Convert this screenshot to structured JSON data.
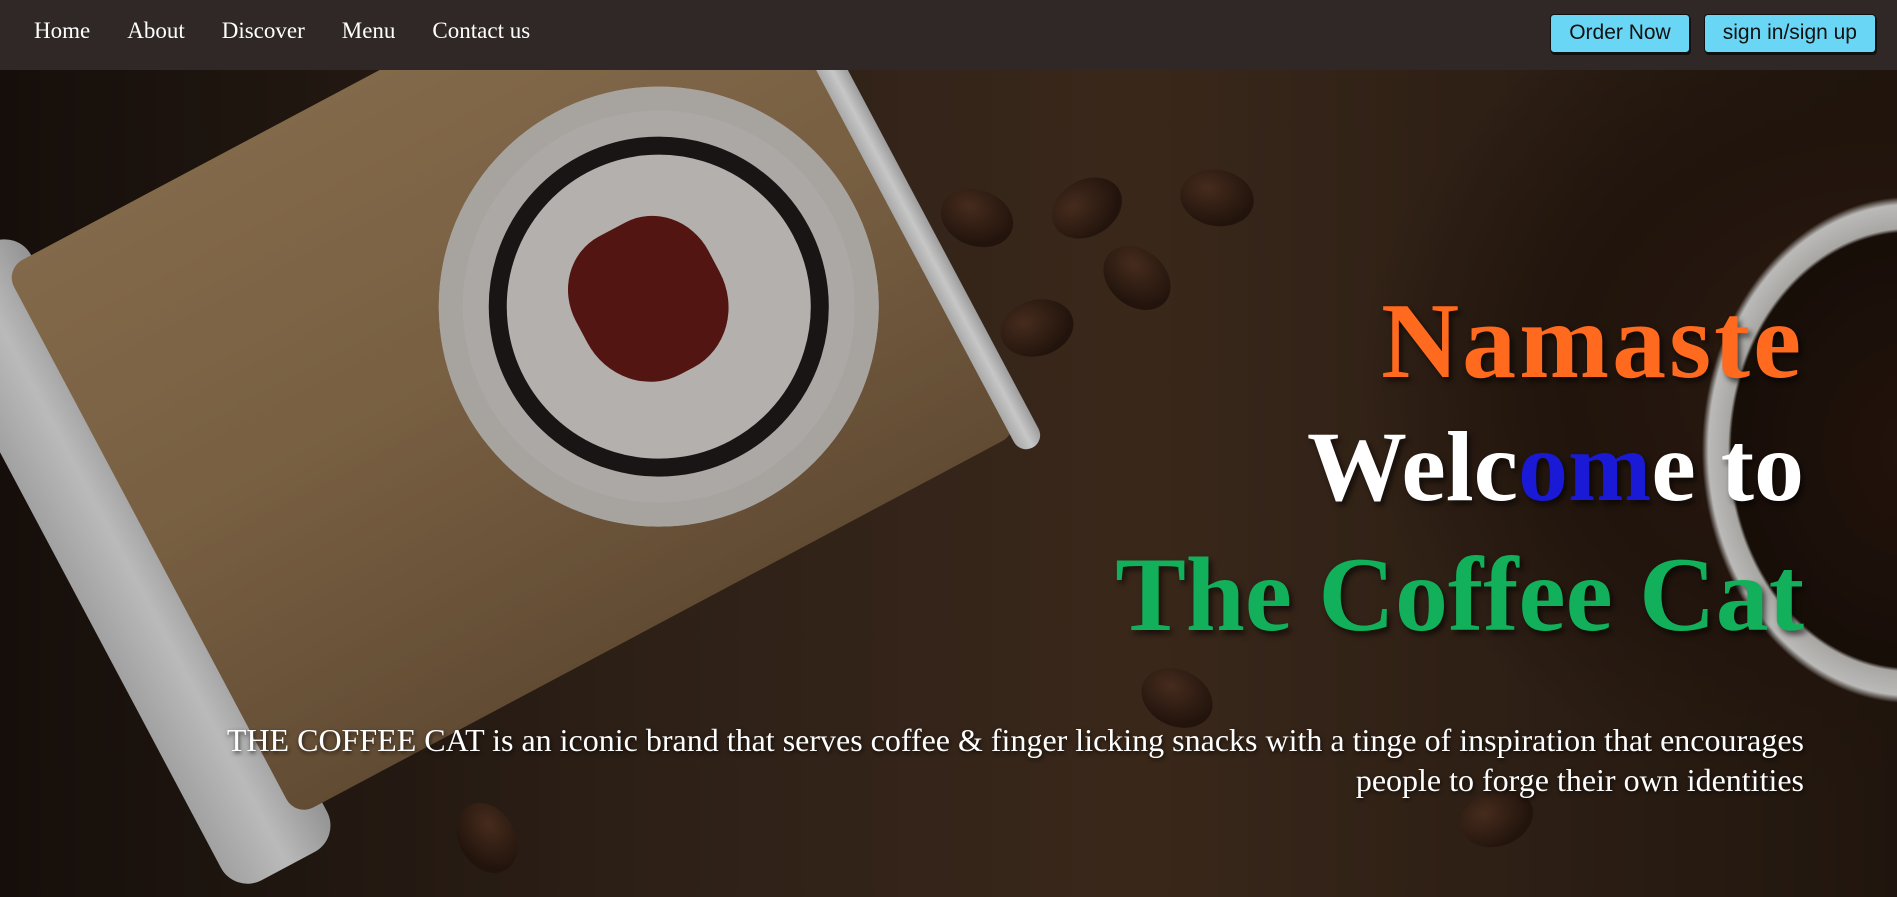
{
  "navbar": {
    "links": [
      "Home",
      "About",
      "Discover",
      "Menu",
      "Contact us"
    ],
    "order_button": "Order Now",
    "signin_button": "sign in/sign up"
  },
  "hero": {
    "greeting": "Namaste",
    "welcome": {
      "part1": "Welc",
      "part2": "om",
      "part3": "e to"
    },
    "brand": "The Coffee Cat",
    "tagline": "THE COFFEE CAT is an iconic brand that serves coffee & finger licking snacks with a tinge of inspiration that encourages people to forge their own identities"
  },
  "colors": {
    "greeting": "#ff6a1f",
    "welcome_accent": "#1a1ad6",
    "brand": "#12b05a",
    "button": "#6ad6f5",
    "navbar": "#2f2826"
  },
  "icons": {
    "hero_image": "coffee-cup-with-cat-logo"
  }
}
